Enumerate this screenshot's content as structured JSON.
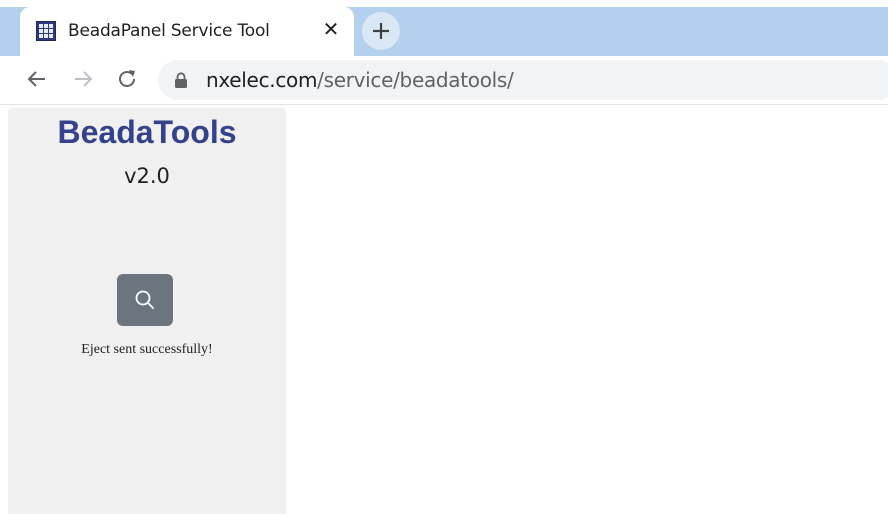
{
  "browser": {
    "tab": {
      "title": "BeadaPanel Service Tool",
      "favicon": "grid-icon",
      "close_glyph": "✕"
    },
    "new_tab_icon": "plus-icon",
    "nav": {
      "back_icon": "arrow-left-icon",
      "forward_icon": "arrow-right-icon",
      "reload_icon": "reload-icon"
    },
    "address": {
      "host": "nxelec.com",
      "path": "/service/beadatools/",
      "lock_icon": "lock-icon"
    }
  },
  "sidebar": {
    "title": "BeadaTools",
    "version": "v2.0",
    "search_button_icon": "search-icon",
    "status_text": "Eject sent successfully!"
  },
  "colors": {
    "tabstrip": "#b3d1ee",
    "title": "#34428c",
    "button": "#6c757d",
    "sidebar": "#f0f0f0"
  }
}
